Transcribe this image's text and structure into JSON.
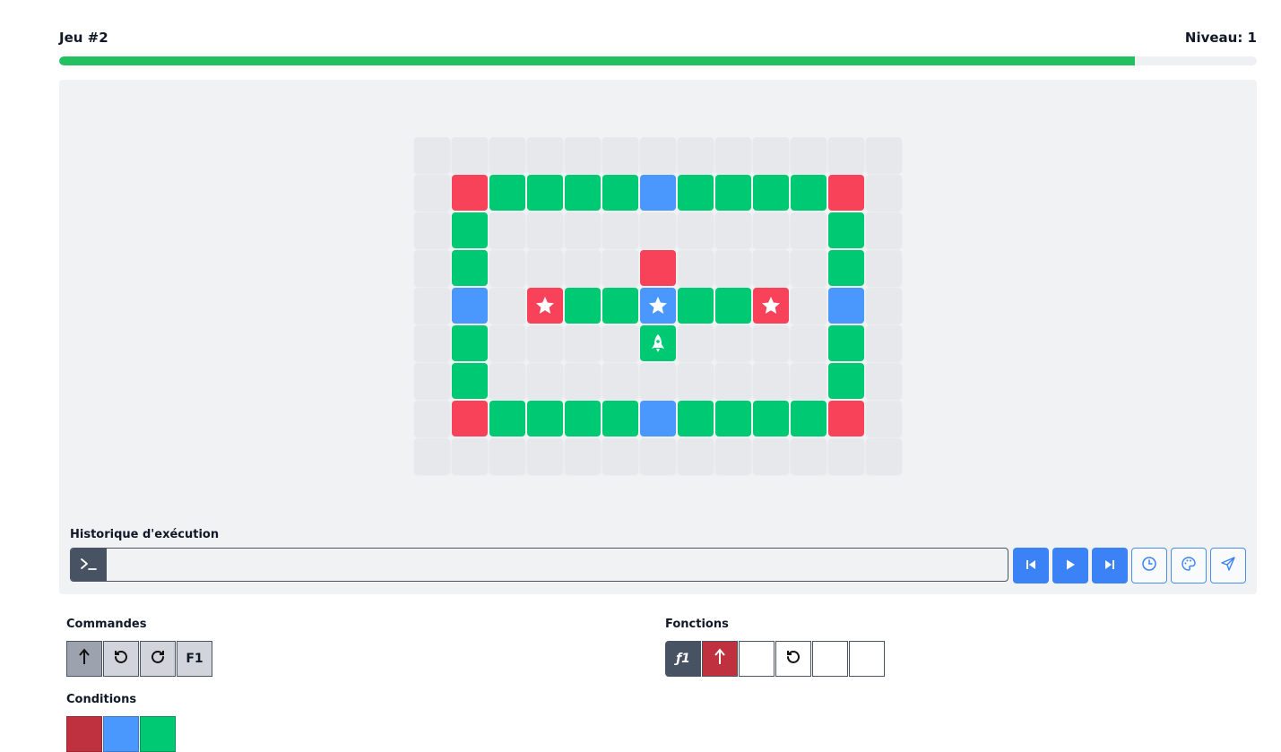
{
  "header": {
    "game_title": "Jeu #2",
    "level_text": "Niveau: 1",
    "progress": 0.898
  },
  "board": {
    "rows": [
      [
        "empty",
        "empty",
        "empty",
        "empty",
        "empty",
        "empty",
        "empty",
        "empty",
        "empty",
        "empty",
        "empty",
        "empty",
        "empty"
      ],
      [
        "empty",
        "red",
        "green",
        "green",
        "green",
        "green",
        "blue",
        "green",
        "green",
        "green",
        "green",
        "red",
        "empty"
      ],
      [
        "empty",
        "green",
        "empty",
        "empty",
        "empty",
        "empty",
        "empty",
        "empty",
        "empty",
        "empty",
        "empty",
        "green",
        "empty"
      ],
      [
        "empty",
        "green",
        "empty",
        "empty",
        "empty",
        "empty",
        "red",
        "empty",
        "empty",
        "empty",
        "empty",
        "green",
        "empty"
      ],
      [
        "empty",
        "blue",
        "empty",
        "red-star",
        "green",
        "green",
        "blue-star",
        "green",
        "green",
        "red-star",
        "empty",
        "blue",
        "empty"
      ],
      [
        "empty",
        "green",
        "empty",
        "empty",
        "empty",
        "empty",
        "green-rocket",
        "empty",
        "empty",
        "empty",
        "empty",
        "green",
        "empty"
      ],
      [
        "empty",
        "green",
        "empty",
        "empty",
        "empty",
        "empty",
        "empty",
        "empty",
        "empty",
        "empty",
        "empty",
        "green",
        "empty"
      ],
      [
        "empty",
        "red",
        "green",
        "green",
        "green",
        "green",
        "blue",
        "green",
        "green",
        "green",
        "green",
        "red",
        "empty"
      ],
      [
        "empty",
        "empty",
        "empty",
        "empty",
        "empty",
        "empty",
        "empty",
        "empty",
        "empty",
        "empty",
        "empty",
        "empty",
        "empty"
      ]
    ],
    "icons": {
      "star": "star-icon",
      "rocket": "rocket-icon"
    }
  },
  "history": {
    "label": "Historique d'exécution",
    "terminal_icon": "terminal-icon"
  },
  "controls": [
    "step-back-icon",
    "play-icon",
    "step-forward-icon",
    "clock-icon",
    "palette-icon",
    "send-icon"
  ],
  "commands": {
    "label": "Commandes",
    "f1_label": "F1",
    "icons": [
      "arrow-up-icon",
      "rotate-left-icon",
      "rotate-right-icon"
    ]
  },
  "functions": {
    "label": "Fonctions",
    "f1_label": "ƒ1"
  },
  "conditions": {
    "label": "Conditions"
  },
  "colors": {
    "red": "#f8425a",
    "green": "#00c973",
    "blue": "#4a98fd",
    "progress": "#22c05e",
    "dark_red": "#c0313f"
  }
}
